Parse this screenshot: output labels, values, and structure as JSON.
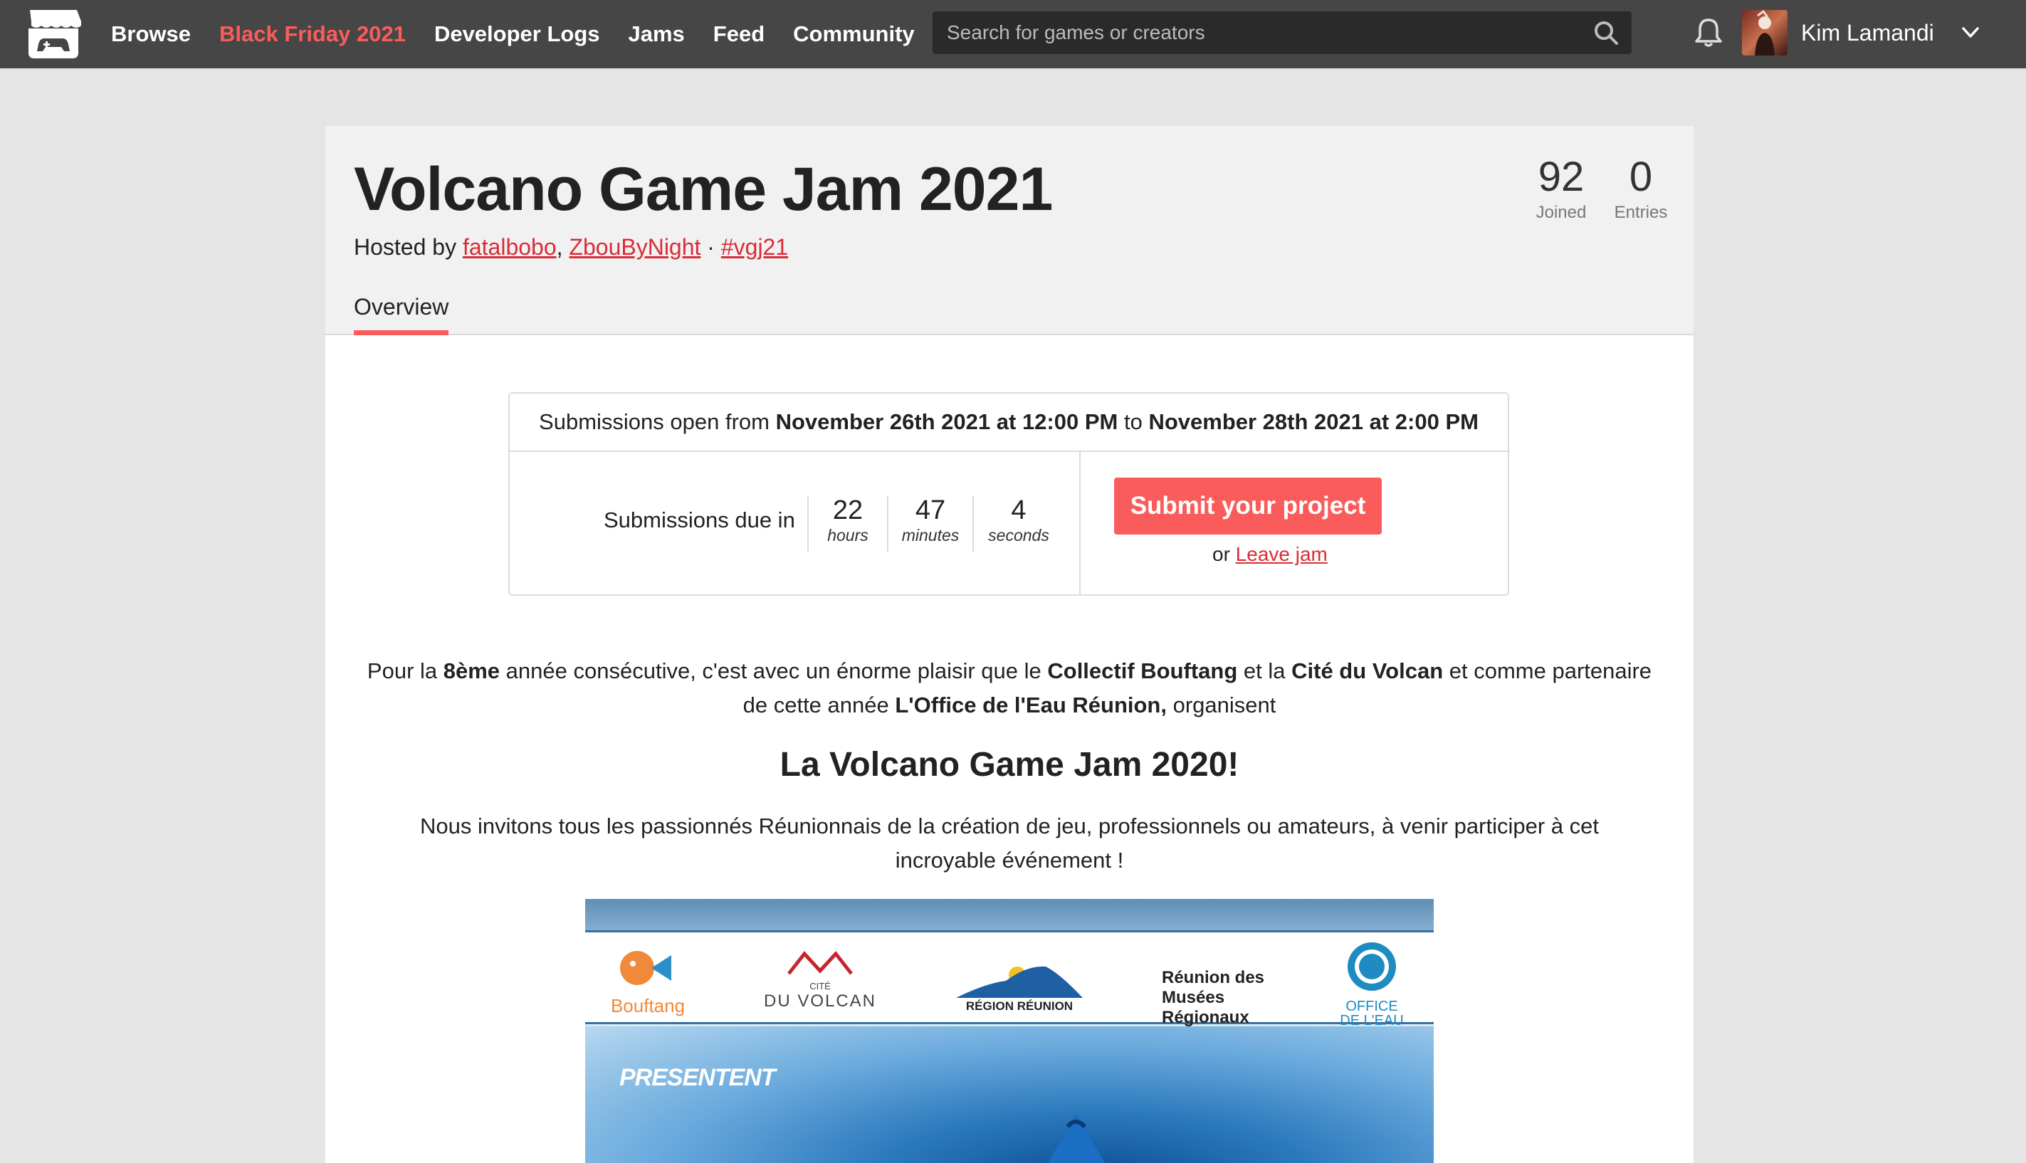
{
  "nav": {
    "browse": "Browse",
    "sale": "Black Friday 2021",
    "devlogs": "Developer Logs",
    "jams": "Jams",
    "feed": "Feed",
    "community": "Community"
  },
  "search": {
    "placeholder": "Search for games or creators"
  },
  "user": {
    "name": "Kim Lamandi"
  },
  "jam": {
    "title": "Volcano Game Jam 2021",
    "hosted_prefix": "Hosted by ",
    "host1": "fatalbobo",
    "host_sep": ", ",
    "host2": "ZbouByNight",
    "tag_sep": " · ",
    "hashtag": "#vgj21",
    "joined_count": "92",
    "joined_label": "Joined",
    "entries_count": "0",
    "entries_label": "Entries",
    "tab_overview": "Overview"
  },
  "submission": {
    "open_prefix": "Submissions open from ",
    "start": "November 26th 2021 at 12:00 PM",
    "to": " to ",
    "end": "November 28th 2021 at 2:00 PM",
    "due_label": "Submissions due in",
    "hours": "22",
    "hours_label": "hours",
    "minutes": "47",
    "minutes_label": "minutes",
    "seconds": "4",
    "seconds_label": "seconds",
    "submit_button": "Submit your project",
    "or": "or ",
    "leave": "Leave jam"
  },
  "description": {
    "p1_a": "Pour la ",
    "p1_b": "8ème",
    "p1_c": " année consécutive, c'est avec un énorme plaisir que le ",
    "p1_d": "Collectif Bouftang",
    "p1_e": " et la ",
    "p1_f": "Cité du Volcan",
    "p1_g": " et comme partenaire de cette  année ",
    "p1_h": "L'Office de l'Eau Réunion,",
    "p1_i": "  organisent",
    "heading": "La Volcano Game Jam 2020!",
    "p2": "Nous invitons tous les passionnés Réunionnais de la création de jeu, professionnels ou amateurs, à venir participer à cet incroyable événement !"
  },
  "banner": {
    "partner1": "Bouftang",
    "partner2": "DU VOLCAN",
    "partner2_small": "CITÉ",
    "partner3": "RÉGION RÉUNION",
    "partner4_line1": "Réunion des",
    "partner4_line2": "Musées",
    "partner4_line3": "Régionaux",
    "partner5_line1": "OFFICE",
    "partner5_line2": "DE L'EAU",
    "presentent": "PRESENTENT"
  },
  "colors": {
    "accent": "#fa5c5c",
    "link": "#da2c38",
    "header_bg": "#464646"
  }
}
